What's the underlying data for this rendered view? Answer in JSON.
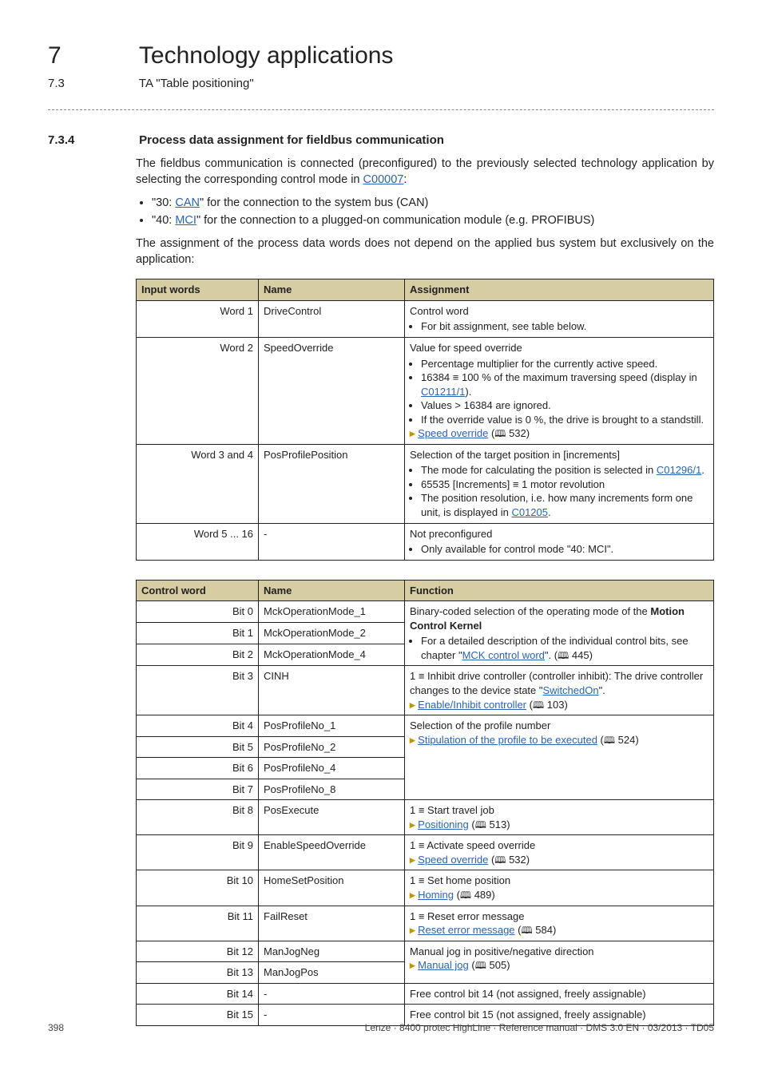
{
  "chapter": {
    "number": "7",
    "title": "Technology applications"
  },
  "section": {
    "number": "7.3",
    "title": "TA \"Table positioning\""
  },
  "subsection": {
    "number": "7.3.4",
    "title": "Process data assignment for fieldbus communication"
  },
  "para1_pre": "The fieldbus communication is connected (preconfigured) to the previously selected technology application by selecting the corresponding control mode in ",
  "para1_link": "C00007",
  "para1_post": ":",
  "bullet_can_pre": "\"30: ",
  "bullet_can_link": "CAN",
  "bullet_can_post": "\" for the connection to the system bus (CAN)",
  "bullet_mci_pre": "\"40: ",
  "bullet_mci_link": "MCI",
  "bullet_mci_post": "\" for the connection to a plugged-on communication module (e.g. PROFIBUS)",
  "para2": "The assignment of the process data words does not depend on the applied bus system but exclusively on the application:",
  "table1": {
    "headers": [
      "Input words",
      "Name",
      "Assignment"
    ],
    "rows": [
      {
        "c1": "Word 1",
        "c2": "DriveControl",
        "c3_main": "Control word",
        "c3_items": [
          "For bit assignment, see table below."
        ]
      },
      {
        "c1": "Word 2",
        "c2": "SpeedOverride",
        "c3_main": "Value for speed override",
        "c3_items_rich": true,
        "c3_item1": "Percentage multiplier for the currently active speed.",
        "c3_item2_pre": "16384 ≡ 100 % of the maximum traversing speed (display in ",
        "c3_item2_link": "C01211/1",
        "c3_item2_post": ").",
        "c3_item3": "Values > 16384 are ignored.",
        "c3_item4": "If the override value is 0 %, the drive is brought to a standstill.",
        "c3_footer_link": "Speed override",
        "c3_footer_page": "532"
      },
      {
        "c1": "Word 3 and 4",
        "c2": "PosProfilePosition",
        "c3_main": "Selection of the target position in [increments]",
        "c3_items_rich2": true,
        "c3_r2_item1_pre": "The mode for calculating the position is selected in ",
        "c3_r2_item1_link": "C01296/1",
        "c3_r2_item1_post": ".",
        "c3_r2_item2": "65535 [Increments] ≡ 1 motor revolution",
        "c3_r2_item3_pre": "The position resolution, i.e. how many increments form one unit, is displayed in ",
        "c3_r2_item3_link": "C01205",
        "c3_r2_item3_post": "."
      },
      {
        "c1": "Word 5 ... 16",
        "c2": "-",
        "c3_main": "Not preconfigured",
        "c3_items": [
          "Only available for control mode \"40: MCI\"."
        ]
      }
    ]
  },
  "table2": {
    "headers": [
      "Control word",
      "Name",
      "Function"
    ],
    "rows": [
      {
        "c1": "Bit 0",
        "c2": "MckOperationMode_1"
      },
      {
        "c1": "Bit 1",
        "c2": "MckOperationMode_2"
      },
      {
        "c1": "Bit 2",
        "c2": "MckOperationMode_4"
      },
      {
        "c1": "Bit 3",
        "c2": "CINH"
      },
      {
        "c1": "Bit 4",
        "c2": "PosProfileNo_1"
      },
      {
        "c1": "Bit 5",
        "c2": "PosProfileNo_2"
      },
      {
        "c1": "Bit 6",
        "c2": "PosProfileNo_4"
      },
      {
        "c1": "Bit 7",
        "c2": "PosProfileNo_8"
      },
      {
        "c1": "Bit 8",
        "c2": "PosExecute"
      },
      {
        "c1": "Bit 9",
        "c2": "EnableSpeedOverride"
      },
      {
        "c1": "Bit 10",
        "c2": "HomeSetPosition"
      },
      {
        "c1": "Bit 11",
        "c2": "FailReset"
      },
      {
        "c1": "Bit 12",
        "c2": "ManJogNeg"
      },
      {
        "c1": "Bit 13",
        "c2": "ManJogPos"
      },
      {
        "c1": "Bit 14",
        "c2": "-"
      },
      {
        "c1": "Bit 15",
        "c2": "-"
      }
    ],
    "fn_group1_pre": "Binary-coded selection of the operating mode of the ",
    "fn_group1_bold": "Motion Control Kernel",
    "fn_group1_item_pre": "For a detailed description of the individual control bits, see chapter \"",
    "fn_group1_item_link": "MCK control word",
    "fn_group1_item_post": "\". (",
    "fn_group1_item_page": "445",
    "fn_bit3_pre": "1 ≡ Inhibit drive controller (controller inhibit): The drive controller changes to the device state \"",
    "fn_bit3_link": "SwitchedOn",
    "fn_bit3_post": "\".",
    "fn_bit3_footer_link": "Enable/Inhibit controller",
    "fn_bit3_footer_page": "103",
    "fn_group2_main": "Selection of the profile number",
    "fn_group2_link": "Stipulation of the profile to be executed",
    "fn_group2_page": "524",
    "fn_bit8_main": "1 ≡ Start travel job",
    "fn_bit8_link": "Positioning",
    "fn_bit8_page": "513",
    "fn_bit9_main": "1 ≡ Activate speed override",
    "fn_bit9_link": "Speed override",
    "fn_bit9_page": "532",
    "fn_bit10_main": "1 ≡ Set home position",
    "fn_bit10_link": "Homing",
    "fn_bit10_page": "489",
    "fn_bit11_main": "1 ≡ Reset error message",
    "fn_bit11_link": "Reset error message",
    "fn_bit11_page": "584",
    "fn_group3_main": "Manual jog in positive/negative direction",
    "fn_group3_link": "Manual jog",
    "fn_group3_page": "505",
    "fn_bit14": "Free control bit 14 (not assigned, freely assignable)",
    "fn_bit15": "Free control bit 15 (not assigned, freely assignable)"
  },
  "footer": {
    "page": "398",
    "source": "Lenze · 8400 protec HighLine · Reference manual · DMS 3.0 EN · 03/2013 · TD05"
  }
}
